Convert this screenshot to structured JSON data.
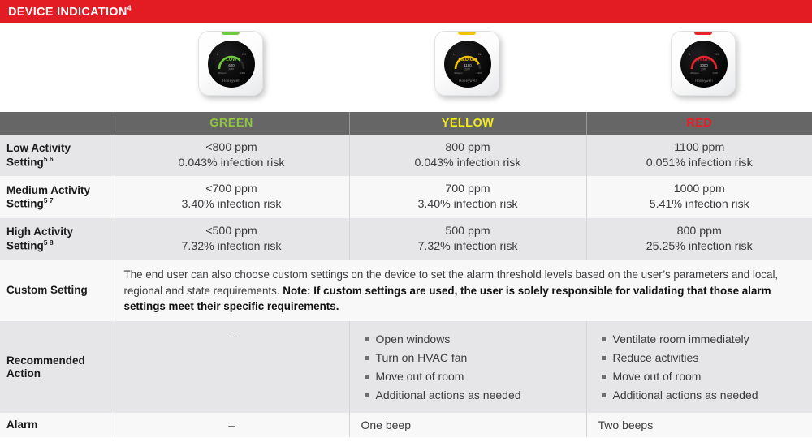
{
  "banner": {
    "title": "DEVICE INDICATION",
    "footnote": "4"
  },
  "devices": [
    {
      "level": "LOW",
      "ppm": "600",
      "unit": "ppm",
      "color": "#6ECB3C",
      "tick_left": "· L",
      "tick_right": "HH ·",
      "scale_left": "400ppm",
      "scale_right": "1400",
      "brand": "Honeywell"
    },
    {
      "level": "MEDIUM",
      "ppm": "1180",
      "unit": "ppm",
      "color": "#F2C200",
      "tick_left": "· L",
      "tick_right": "HH ·",
      "scale_left": "400ppm",
      "scale_right": "1400",
      "brand": "Honeywell"
    },
    {
      "level": "HIGH",
      "ppm": "2000",
      "unit": "ppm",
      "color": "#E8232A",
      "tick_left": "· L",
      "tick_right": "HH ·",
      "scale_left": "400ppm",
      "scale_right": "1400",
      "brand": "Honeywell"
    }
  ],
  "colors": {
    "banner_red": "#E31B23",
    "header_gray": "#666666",
    "green": "#8DC63F",
    "yellow": "#F3EC1B",
    "red": "#ED1C24"
  },
  "table": {
    "headers": {
      "blank": "",
      "green": "GREEN",
      "yellow": "YELLOW",
      "red": "RED"
    },
    "rows": [
      {
        "label": "Low Activity Setting",
        "sup": "5 6",
        "green": [
          "<800 ppm",
          "0.043% infection risk"
        ],
        "yellow": [
          "800 ppm",
          "0.043% infection risk"
        ],
        "red": [
          "1100 ppm",
          "0.051% infection risk"
        ]
      },
      {
        "label": "Medium Activity Setting",
        "sup": "5 7",
        "green": [
          "<700 ppm",
          "3.40% infection risk"
        ],
        "yellow": [
          "700 ppm",
          "3.40% infection risk"
        ],
        "red": [
          "1000 ppm",
          "5.41% infection risk"
        ]
      },
      {
        "label": "High Activity Setting",
        "sup": "5 8",
        "green": [
          "<500 ppm",
          "7.32% infection risk"
        ],
        "yellow": [
          "500 ppm",
          "7.32% infection risk"
        ],
        "red": [
          "800 ppm",
          "25.25% infection risk"
        ]
      }
    ],
    "custom": {
      "label": "Custom Setting",
      "text": "The end user can also choose custom settings on the device to set the alarm threshold levels based on the user’s parameters and local, regional and state requirements. ",
      "note": "Note: If custom settings are used, the user is solely responsible for validating that those alarm settings meet their specific requirements."
    },
    "recommended": {
      "label": "Recommended Action",
      "green": "–",
      "yellow": [
        "Open windows",
        "Turn on HVAC fan",
        "Move out of room",
        "Additional actions as needed"
      ],
      "red": [
        "Ventilate room immediately",
        "Reduce activities",
        "Move out of room",
        "Additional actions as needed"
      ]
    },
    "alarm": {
      "label": "Alarm",
      "green": "–",
      "yellow": "One beep",
      "red": "Two beeps"
    }
  }
}
